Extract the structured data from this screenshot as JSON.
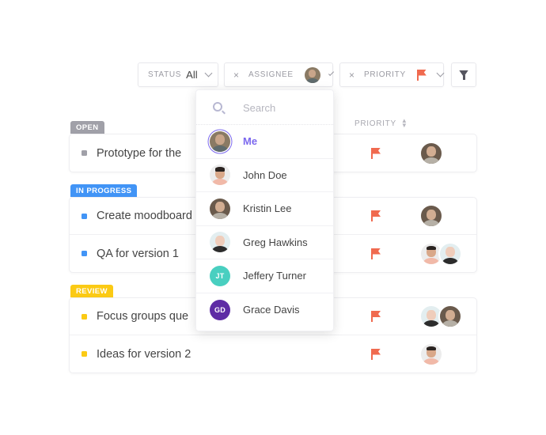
{
  "filters": {
    "status": {
      "label": "STATUS",
      "value": "All"
    },
    "assignee": {
      "clear": "×",
      "label": "ASSIGNEE",
      "avatar": "me"
    },
    "priority": {
      "clear": "×",
      "label": "PRIORITY",
      "icon": "flag-icon"
    },
    "filter_icon": "funnel-icon"
  },
  "columns": {
    "priority": "PRIORITY"
  },
  "colors": {
    "open": "#a0a0a8",
    "in_progress": "#4194f6",
    "review": "#fbca14",
    "flag": "#f06a4f",
    "accent": "#7b68ee"
  },
  "groups": [
    {
      "status": "OPEN",
      "tasks": [
        {
          "name": "Prototype for the",
          "assignees": [
            "kristin"
          ]
        }
      ]
    },
    {
      "status": "IN PROGRESS",
      "tasks": [
        {
          "name": "Create moodboard",
          "assignees": [
            "kristin"
          ]
        },
        {
          "name": "QA for version 1",
          "assignees": [
            "john",
            "greg"
          ]
        }
      ]
    },
    {
      "status": "REVIEW",
      "tasks": [
        {
          "name": "Focus groups que",
          "assignees": [
            "greg",
            "kristin"
          ]
        },
        {
          "name": "Ideas for version 2",
          "assignees": [
            "john"
          ]
        }
      ]
    }
  ],
  "dropdown": {
    "search_placeholder": "Search",
    "people": [
      {
        "name": "Me",
        "selected": true
      },
      {
        "name": "John Doe"
      },
      {
        "name": "Kristin Lee"
      },
      {
        "name": "Greg Hawkins"
      },
      {
        "name": "Jeffery Turner",
        "initials": "JT",
        "color": "#49cfc0"
      },
      {
        "name": "Grace Davis",
        "initials": "GD",
        "color": "#5e2ca5"
      }
    ]
  }
}
